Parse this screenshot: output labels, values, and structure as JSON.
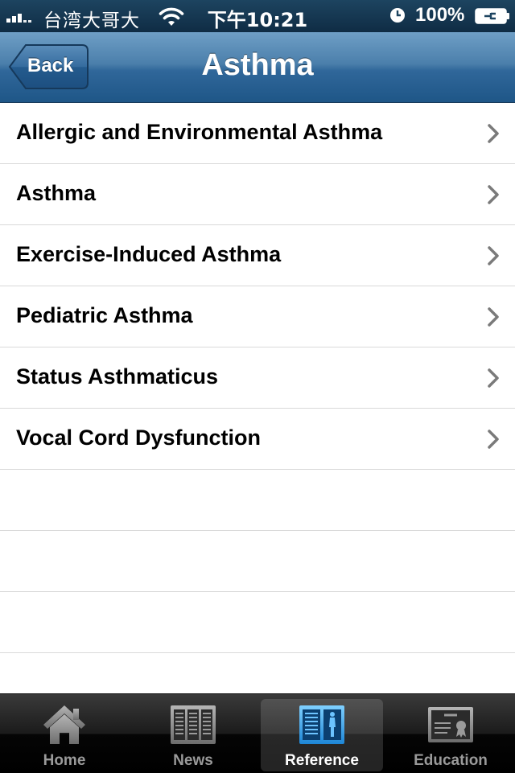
{
  "status_bar": {
    "carrier": "台湾大哥大",
    "time": "下午10:21",
    "battery": "100%"
  },
  "nav": {
    "back_label": "Back",
    "title": "Asthma"
  },
  "list": {
    "items": [
      {
        "label": "Allergic and Environmental Asthma"
      },
      {
        "label": "Asthma"
      },
      {
        "label": "Exercise-Induced Asthma"
      },
      {
        "label": "Pediatric Asthma"
      },
      {
        "label": "Status Asthmaticus"
      },
      {
        "label": "Vocal Cord Dysfunction"
      }
    ]
  },
  "tab_bar": {
    "tabs": [
      {
        "label": "Home",
        "icon": "house-icon"
      },
      {
        "label": "News",
        "icon": "newspaper-icon"
      },
      {
        "label": "Reference",
        "icon": "book-icon",
        "selected": true
      },
      {
        "label": "Education",
        "icon": "certificate-icon"
      }
    ]
  },
  "colors": {
    "nav_bar": "#30679a",
    "tab_bar": "#1b1b1b",
    "chevron": "#7a7a7a",
    "selected_tab_label": "#ffffff",
    "tab_label": "#9a9a9a"
  }
}
